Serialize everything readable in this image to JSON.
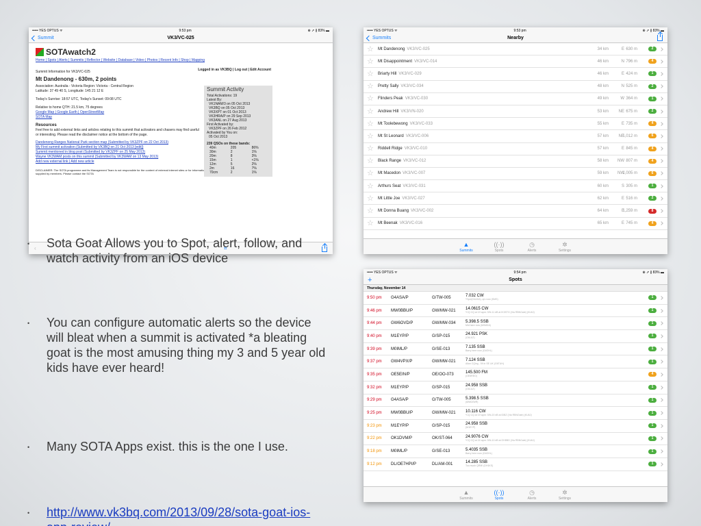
{
  "slide": {
    "bullets": [
      {
        "text": "Sota Goat Allows you to Spot, alert, follow, and watch activity from an iOS device"
      },
      {
        "text": "You can configure automatic alerts so the device will bleat when a summit is activated *a bleating goat is the most amusing thing my 3 and 5 year old kids have ever heard!"
      },
      {
        "text": "Many SOTA Apps exist. this is the one I use."
      },
      {
        "text": "http://www.vk3bq.com/2013/09/28/sota-goat-ios-app-review/",
        "is_link": true
      }
    ],
    "bullet_glyph": "•"
  },
  "screen1": {
    "status": {
      "carrier": "••••• YES OPTUS ᯤ",
      "time": "9:53 pm",
      "battery": "⊕ ➚ ∦ 83% ▬"
    },
    "nav": {
      "back": "Summit",
      "title": "VK3/VC-025"
    },
    "web": {
      "logo": "SOTAwatch2",
      "login": "Logged in as VK3BQ | Log out | Edit Account",
      "links": "Home | Spots | Alerts | Summits | Reflector | Website | Database | Video | Photos | Recent Info | Shop | Mapping",
      "info_head": "Summit Information for VK3/VC-025",
      "summit": "Mt Dandenong - 630m, 2 points",
      "assoc": "Association: Australia - Victoria  Region: Victoria - Central Region",
      "latlon": "Latitude: 37 49 40 S, Longitude: 145 21 12 E",
      "sun": "Today's Sunrise: 18:57 UTC, Today's Sunset: 09:08 UTC",
      "qth": "Relative to home QTH: 21.5 km, 75 degrees",
      "maps": "Google Map | Google Earth | OpenStreetMap",
      "sota_map": "SOTA Map",
      "res_head": "Resources",
      "res_text": "Feel free to add external links and articles relating to this summit that activators and chasers may find useful or interesting. Please read the disclaimer notice at the bottom of the page.",
      "res_links": [
        "Dandenong Ranges National Park section map (Submitted by VK3ZPF on 22 Oct 2013)",
        "My First summit activation (Submitted by VK3BQ on 21 Oct 2013 [edit])",
        "Summit mentioned in blog post (Submitted by VK3ZPF on 25 May 2013)",
        "Wayne VK3WAM posts on this summit (Submitted by VK3WAM on 13 May 2013)",
        "Add new external link | Add new article"
      ],
      "disclaimer": "DISCLAIMER: The SOTA programme and its Management Team is not responsible for the content of external internet sites or for information supplied by members. Please contact the SOTA",
      "activity": {
        "title": "Summit Activity",
        "total": "Total Activations: 19",
        "latest_label": "Latest By:",
        "latest": [
          "VK1NAM/3 on 05 Oct 2013",
          "VK3BQ on 05 Oct 2013",
          "VK3XPT on 01 Oct 2013",
          "VK3HRA/P on 29 Sep 2013",
          "VK3ANL on 27 Aug 2013"
        ],
        "first_label": "First Activated by:",
        "first": "VK3ZPF on 26 Feb 2012",
        "you_label": "Activated by You on:",
        "you": "05 Oct 2013",
        "qsos": "239 QSOs on these bands:",
        "bands": [
          [
            "40m",
            "205",
            "86%"
          ],
          [
            "30m",
            "2",
            "1%"
          ],
          [
            "20m",
            "8",
            "3%"
          ],
          [
            "15m",
            "1",
            "<1%"
          ],
          [
            "12m",
            "5",
            "2%"
          ],
          [
            "2m",
            "16",
            "7%"
          ],
          [
            "70cm",
            "2",
            "1%"
          ]
        ]
      }
    }
  },
  "screen2": {
    "status": {
      "carrier": "••••• YES OPTUS ᯤ",
      "time": "9:53 pm",
      "battery": "⊕ ➚ ∦ 83% ▬"
    },
    "nav": {
      "back": "Summits",
      "title": "Nearby"
    },
    "rows": [
      {
        "name": "Mt Dandenong",
        "code": "VK3/VC-025",
        "dist": "34 km",
        "dir": "E",
        "elev": "630 m",
        "pts": "2",
        "color": "#4cae3f"
      },
      {
        "name": "Mt Disappointment",
        "code": "VK3/VC-014",
        "dist": "46 km",
        "dir": "N",
        "elev": "796 m",
        "pts": "4",
        "color": "#f0a21d"
      },
      {
        "name": "Briarty Hill",
        "code": "VK3/VC-029",
        "dist": "46 km",
        "dir": "E",
        "elev": "424 m",
        "pts": "1",
        "color": "#4cae3f"
      },
      {
        "name": "Pretty Sally",
        "code": "VK3/VC-034",
        "dist": "48 km",
        "dir": "N",
        "elev": "525 m",
        "pts": "2",
        "color": "#4cae3f"
      },
      {
        "name": "Flinders Peak",
        "code": "VK3/VC-030",
        "dist": "49 km",
        "dir": "W",
        "elev": "364 m",
        "pts": "1",
        "color": "#4cae3f"
      },
      {
        "name": "Andrew Hill",
        "code": "VK3/VN-020",
        "dist": "53 km",
        "dir": "NE",
        "elev": "675 m",
        "pts": "2",
        "color": "#4cae3f"
      },
      {
        "name": "Mt Toolebewong",
        "code": "VK3/VC-033",
        "dist": "55 km",
        "dir": "E",
        "elev": "735 m",
        "pts": "4",
        "color": "#f0a21d"
      },
      {
        "name": "Mt St Leonard",
        "code": "VK3/VC-006",
        "dist": "57 km",
        "dir": "NE",
        "elev": "1,012 m",
        "pts": "6",
        "color": "#f0a21d"
      },
      {
        "name": "Riddell Ridge",
        "code": "VK3/VC-010",
        "dist": "57 km",
        "dir": "E",
        "elev": "845 m",
        "pts": "4",
        "color": "#f0a21d"
      },
      {
        "name": "Black Range",
        "code": "VK3/VC-012",
        "dist": "58 km",
        "dir": "NW",
        "elev": "807 m",
        "pts": "4",
        "color": "#f0a21d"
      },
      {
        "name": "Mt Macedon",
        "code": "VK3/VC-007",
        "dist": "59 km",
        "dir": "NW",
        "elev": "1,005 m",
        "pts": "6",
        "color": "#f0a21d"
      },
      {
        "name": "Arthurs Seat",
        "code": "VK3/VC-031",
        "dist": "60 km",
        "dir": "S",
        "elev": "305 m",
        "pts": "1",
        "color": "#4cae3f"
      },
      {
        "name": "Mt Little Joe",
        "code": "VK3/VC-027",
        "dist": "62 km",
        "dir": "E",
        "elev": "516 m",
        "pts": "2",
        "color": "#4cae3f"
      },
      {
        "name": "Mt Donna Buang",
        "code": "VK3/VC-002",
        "dist": "64 km",
        "dir": "E",
        "elev": "1,259 m",
        "pts": "8",
        "color": "#d42a2a"
      },
      {
        "name": "Mt Beenak",
        "code": "VK3/VC-016",
        "dist": "65 km",
        "dir": "E",
        "elev": "745 m",
        "pts": "4",
        "color": "#f0a21d"
      }
    ],
    "tabs": [
      {
        "label": "Summits",
        "icon": "▲",
        "active": true
      },
      {
        "label": "Spots",
        "icon": "((·))",
        "active": false
      },
      {
        "label": "Alerts",
        "icon": "◷",
        "active": false
      },
      {
        "label": "Settings",
        "icon": "✲",
        "active": false
      }
    ]
  },
  "screen3": {
    "status": {
      "carrier": "••••• YES OPTUS ᯤ",
      "time": "9:54 pm",
      "battery": "⊕ ➚ ∦ 83% ▬"
    },
    "nav": {
      "plus": "+",
      "title": "Spots"
    },
    "day": "Thursday, November 14",
    "rows": [
      {
        "time": "9:50 pm",
        "call": "G4ASA/P",
        "ref": "G/TW-005",
        "freq": "7.032 CW",
        "note": "*Spot(G4ASA), qrv now (SMS)",
        "pts": "1",
        "color": "#4cae3f",
        "tcolor": "#d0021b"
      },
      {
        "time": "9:46 pm",
        "call": "MW0BBU/P",
        "ref": "GW/MW-021",
        "freq": "14.0615 CW",
        "note": "*CQ CQ at 19 wpm: 5/N-11 dB at IK3STG (Via RBNGate) (KU6J)",
        "pts": "1",
        "color": "#4cae3f",
        "tcolor": "#d0021b"
      },
      {
        "time": "9:44 pm",
        "call": "GW6OVD/P",
        "ref": "GW/MW-034",
        "freq": "5.398.5 SSB",
        "note": "Mid hare now (M0MDA)",
        "pts": "1",
        "color": "#4cae3f",
        "tcolor": "#d0021b"
      },
      {
        "time": "9:40 pm",
        "call": "M1EYP/P",
        "ref": "G/SP-015",
        "freq": "24.921 PSK",
        "note": "(G6LUZ)",
        "pts": "1",
        "color": "#4cae3f",
        "tcolor": "#d0021b"
      },
      {
        "time": "9:39 pm",
        "call": "M0IML/P",
        "ref": "G/SE-013",
        "freq": "7.135 SSB",
        "note": "Barry here now (G4OHL)",
        "pts": "1",
        "color": "#4cae3f",
        "tcolor": "#d0021b"
      },
      {
        "time": "9:37 pm",
        "call": "GW4VPX/P",
        "ref": "GW/MW-021",
        "freq": "7.124 SSB",
        "note": "Allan CQing - 59 in SE UK (G6TUH)",
        "pts": "1",
        "color": "#4cae3f",
        "tcolor": "#d0021b"
      },
      {
        "time": "9:35 pm",
        "call": "OE5EIN/P",
        "ref": "OE/OO-073",
        "freq": "145.500 FM",
        "note": "(OE5REO)",
        "pts": "4",
        "color": "#f0a21d",
        "tcolor": "#d0021b"
      },
      {
        "time": "9:32 pm",
        "call": "M1EYP/P",
        "ref": "G/SP-015",
        "freq": "24.958 SSB",
        "note": "(G6LUZ)",
        "pts": "1",
        "color": "#4cae3f",
        "tcolor": "#d0021b"
      },
      {
        "time": "9:29 pm",
        "call": "G4ASA/P",
        "ref": "G/TW-005",
        "freq": "5.398.5 SSB",
        "note": "(MW0ZWR)",
        "pts": "1",
        "color": "#4cae3f",
        "tcolor": "#d0021b"
      },
      {
        "time": "9:25 pm",
        "call": "MW0BBU/P",
        "ref": "GW/MW-021",
        "freq": "10.116 CW",
        "note": "*CQ CQ at 19 wpm: 5/N-20 dB at IDBZ (Via RBNGate) (KU6J)",
        "pts": "1",
        "color": "#4cae3f",
        "tcolor": "#d0021b"
      },
      {
        "time": "9:23 pm",
        "call": "M1EYP/P",
        "ref": "G/SP-015",
        "freq": "24.958 SSB",
        "note": "(M1EYP)",
        "pts": "1",
        "color": "#4cae3f",
        "tcolor": "#f29100"
      },
      {
        "time": "9:22 pm",
        "call": "OK1DVM/P",
        "ref": "OK/ST-064",
        "freq": "24.9076 CW",
        "note": "*CQ CQ at 24 wpm: 5/N-10 dB at OH8BG (Via RBNGate) (KU6J)",
        "pts": "1",
        "color": "#4cae3f",
        "tcolor": "#f29100"
      },
      {
        "time": "9:18 pm",
        "call": "M0IML/P",
        "ref": "G/SE-013",
        "freq": "5.4035 SSB",
        "note": "Barry here now (G4OHL)",
        "pts": "1",
        "color": "#4cae3f",
        "tcolor": "#f29100"
      },
      {
        "time": "9:12 pm",
        "call": "DL/OE7HPI/P",
        "ref": "DL/AM-001",
        "freq": "14.285 SSB",
        "note": "Too much QRM! (DH1KS)",
        "pts": "1",
        "color": "#4cae3f",
        "tcolor": "#f29100"
      }
    ],
    "tabs": [
      {
        "label": "Summits",
        "icon": "▲",
        "active": false
      },
      {
        "label": "Spots",
        "icon": "((·))",
        "active": true
      },
      {
        "label": "Alerts",
        "icon": "◷",
        "active": false
      },
      {
        "label": "Settings",
        "icon": "✲",
        "active": false
      }
    ]
  }
}
